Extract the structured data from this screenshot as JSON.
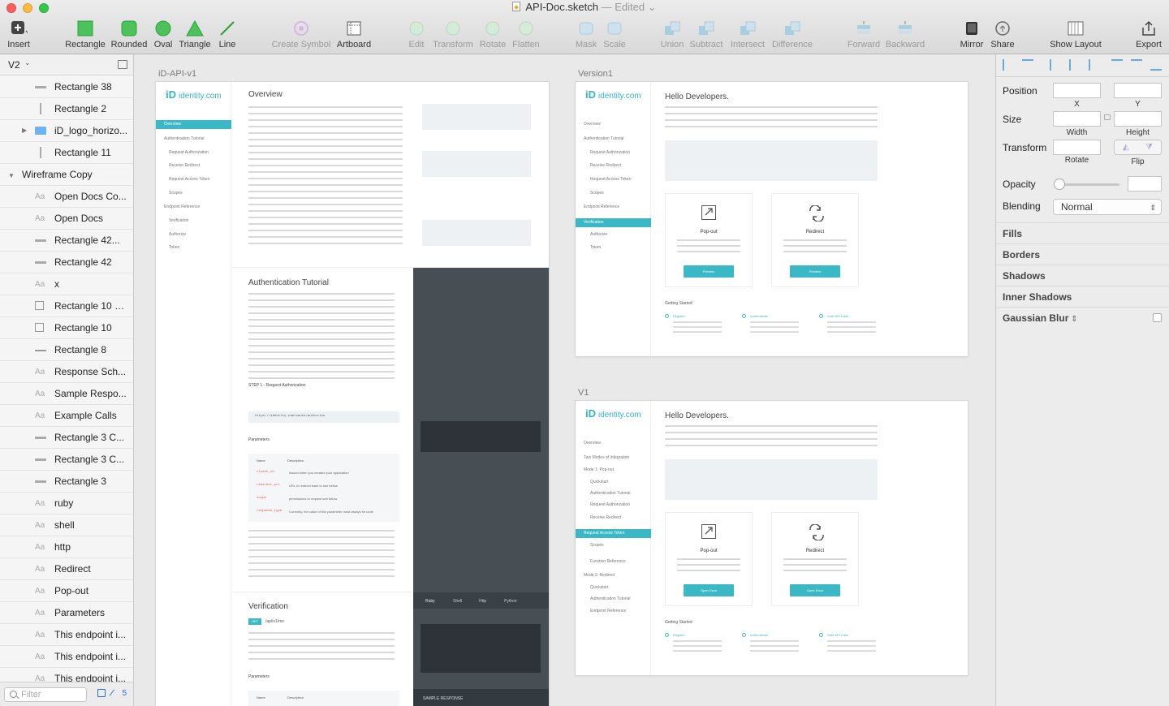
{
  "window": {
    "title": "API-Doc.sketch",
    "status": "Edited",
    "edited_suffix": "— Edited ⌄"
  },
  "toolbar": {
    "items": [
      {
        "label": "Insert",
        "icon": "insert-icon",
        "enabled": true
      },
      {
        "label": "Rectangle",
        "icon": "rectangle-icon",
        "enabled": true
      },
      {
        "label": "Rounded",
        "icon": "rounded-rectangle-icon",
        "enabled": true
      },
      {
        "label": "Oval",
        "icon": "oval-icon",
        "enabled": true
      },
      {
        "label": "Triangle",
        "icon": "triangle-icon",
        "enabled": true
      },
      {
        "label": "Line",
        "icon": "line-icon",
        "enabled": true
      },
      {
        "label": "Create Symbol",
        "icon": "create-symbol-icon",
        "enabled": false
      },
      {
        "label": "Artboard",
        "icon": "artboard-icon",
        "enabled": true
      },
      {
        "label": "Edit",
        "icon": "edit-icon",
        "enabled": false
      },
      {
        "label": "Transform",
        "icon": "transform-icon",
        "enabled": false
      },
      {
        "label": "Rotate",
        "icon": "rotate-icon",
        "enabled": false
      },
      {
        "label": "Flatten",
        "icon": "flatten-icon",
        "enabled": false
      },
      {
        "label": "Mask",
        "icon": "mask-icon",
        "enabled": false
      },
      {
        "label": "Scale",
        "icon": "scale-icon",
        "enabled": false
      },
      {
        "label": "Union",
        "icon": "union-icon",
        "enabled": false
      },
      {
        "label": "Subtract",
        "icon": "subtract-icon",
        "enabled": false
      },
      {
        "label": "Intersect",
        "icon": "intersect-icon",
        "enabled": false
      },
      {
        "label": "Difference",
        "icon": "difference-icon",
        "enabled": false
      },
      {
        "label": "Forward",
        "icon": "forward-icon",
        "enabled": false
      },
      {
        "label": "Backward",
        "icon": "backward-icon",
        "enabled": false
      },
      {
        "label": "Mirror",
        "icon": "mirror-icon",
        "enabled": true
      },
      {
        "label": "Share",
        "icon": "share-icon",
        "enabled": true
      },
      {
        "label": "Show Layout",
        "icon": "show-layout-icon",
        "enabled": true
      },
      {
        "label": "Export",
        "icon": "export-icon",
        "enabled": true
      }
    ]
  },
  "layers_panel": {
    "page": "V2",
    "layers": [
      {
        "name": "Rectangle 38",
        "kind": "rect"
      },
      {
        "name": "Rectangle 2",
        "kind": "vline"
      },
      {
        "name": "iD_logo_horizo...",
        "kind": "folder"
      },
      {
        "name": "Rectangle 11",
        "kind": "vline"
      },
      {
        "name": "Wireframe Copy",
        "kind": "group"
      },
      {
        "name": "Open Docs Co...",
        "kind": "text"
      },
      {
        "name": "Open Docs",
        "kind": "text"
      },
      {
        "name": "Rectangle 42...",
        "kind": "rect"
      },
      {
        "name": "Rectangle 42",
        "kind": "rect"
      },
      {
        "name": "x",
        "kind": "text"
      },
      {
        "name": "Rectangle 10 C...",
        "kind": "square"
      },
      {
        "name": "Rectangle 10",
        "kind": "square"
      },
      {
        "name": "Rectangle 8",
        "kind": "hline"
      },
      {
        "name": "Response Sch...",
        "kind": "text"
      },
      {
        "name": "Sample Respo...",
        "kind": "text"
      },
      {
        "name": "Example Calls",
        "kind": "text"
      },
      {
        "name": "Rectangle 3 C...",
        "kind": "rect"
      },
      {
        "name": "Rectangle 3 C...",
        "kind": "rect"
      },
      {
        "name": "Rectangle 3",
        "kind": "rect"
      },
      {
        "name": "ruby",
        "kind": "text"
      },
      {
        "name": "shell",
        "kind": "text"
      },
      {
        "name": "http",
        "kind": "text"
      },
      {
        "name": "Redirect",
        "kind": "text"
      },
      {
        "name": "Pop-out",
        "kind": "text"
      },
      {
        "name": "Parameters",
        "kind": "text"
      },
      {
        "name": "This endpoint i...",
        "kind": "text"
      },
      {
        "name": "This endpoint i...",
        "kind": "text"
      },
      {
        "name": "This endpoint i...",
        "kind": "text"
      }
    ],
    "filter_placeholder": "Filter",
    "count": "5"
  },
  "canvas": {
    "artboards": [
      {
        "label": "iD-API-v1",
        "logo": "identity.com",
        "nav": [
          "Overview",
          "Authentication Tutorial",
          "Request Authorization",
          "Receive Redirect",
          "Request Access Token",
          "Scopes",
          "Endpoint Reference",
          "Verification",
          "Authorize",
          "Token"
        ],
        "sections": [
          "Overview",
          "Authentication Tutorial",
          "Verification"
        ],
        "step": "STEP 1 - Request Authorization",
        "url": "https://identity.com/oauth/authorize",
        "params_title": "Parameters",
        "param_cols": [
          "Name",
          "Description"
        ],
        "params": [
          {
            "name": "client_id",
            "desc": "Issued when you created your application"
          },
          {
            "name": "redirect_uri",
            "desc": "URL to redirect back to see below"
          },
          {
            "name": "scope",
            "desc": "permissions to request see below"
          },
          {
            "name": "response_type",
            "desc": "Currently, the value of this parameter must always be code"
          }
        ],
        "code_tabs": [
          "Ruby",
          "Shell",
          "Http",
          "Python"
        ],
        "get_badge": "GET",
        "endpoint": "/api/v1/me",
        "sample_response": "SAMPLE RESPONSE"
      },
      {
        "label": "Version1",
        "logo": "identity.com",
        "heading": "Hello Developers.",
        "nav": [
          "Overview",
          "Authentication Tutorial",
          "Request Authorization",
          "Receive Redirect",
          "Request Access Token",
          "Scopes",
          "Endpoint Reference",
          "Verification",
          "Authorize",
          "Token"
        ],
        "cards": [
          {
            "title": "Pop-out",
            "button": "Preview"
          },
          {
            "title": "Redirect",
            "button": "Preview"
          }
        ],
        "getting_started": "Getting Started",
        "links": [
          "Register",
          "Authenticate",
          "Start API Calls"
        ]
      },
      {
        "label": "V1",
        "logo": "identity.com",
        "heading": "Hello Developers.",
        "nav": [
          "Overview",
          "Two Modes of Integration",
          "Mode 1: Pop-out",
          "Quickstart",
          "Authentication Tutorial",
          "Request Authorization",
          "Receive Redirect",
          "Request Access Token",
          "Scopes",
          "Function Reference",
          "Mode 2: Redirect",
          "Quickstart",
          "Authentication Tutorial",
          "Endpoint Reference"
        ],
        "cards": [
          {
            "title": "Pop-out",
            "button": "Open Docs"
          },
          {
            "title": "Redirect",
            "button": "Open Docs"
          }
        ],
        "getting_started": "Getting Started",
        "links": [
          "Register",
          "Authenticate",
          "Start API Calls"
        ]
      }
    ]
  },
  "inspector": {
    "position_label": "Position",
    "x_label": "X",
    "y_label": "Y",
    "size_label": "Size",
    "width_label": "Width",
    "height_label": "Height",
    "transform_label": "Transform",
    "rotate_label": "Rotate",
    "flip_label": "Flip",
    "opacity_label": "Opacity",
    "blending_label": "Blending",
    "blending_value": "Normal",
    "sections": [
      "Fills",
      "Borders",
      "Shadows",
      "Inner Shadows",
      "Gaussian Blur"
    ]
  },
  "colors": {
    "accent_teal": "#3bb8c6",
    "dark_panel": "#474f55",
    "toolbar_green": "#4cc25a",
    "close": "#fc605c",
    "minimize": "#fdbc40",
    "maximize": "#34c84a"
  }
}
